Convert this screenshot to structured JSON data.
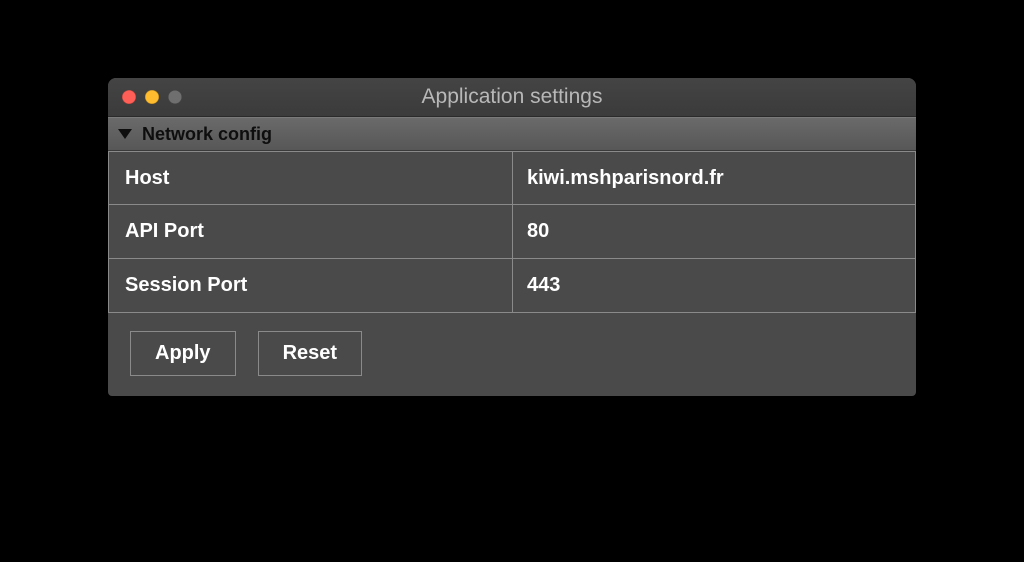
{
  "window": {
    "title": "Application settings"
  },
  "section": {
    "title": "Network config"
  },
  "fields": {
    "host": {
      "label": "Host",
      "value": "kiwi.mshparisnord.fr"
    },
    "api_port": {
      "label": "API Port",
      "value": "80"
    },
    "session_port": {
      "label": "Session Port",
      "value": "443"
    }
  },
  "buttons": {
    "apply": "Apply",
    "reset": "Reset"
  }
}
